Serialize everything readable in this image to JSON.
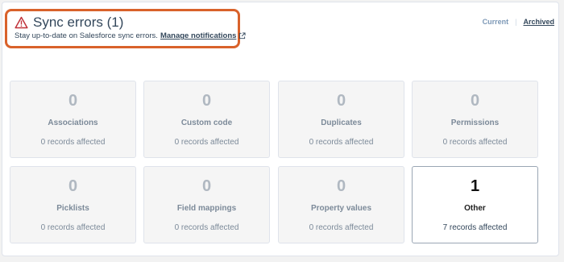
{
  "header": {
    "title": "Sync errors (1)",
    "subtitle": "Stay up-to-date on Salesforce sync errors.",
    "manage_link": "Manage notifications",
    "warning_icon": "warning-triangle-icon",
    "external_icon": "external-link-icon",
    "accent_color": "#d9622b"
  },
  "view_toggle": {
    "current": "Current",
    "separator": "|",
    "archived": "Archived"
  },
  "cards": [
    {
      "count": "0",
      "label": "Associations",
      "affected": "0 records affected"
    },
    {
      "count": "0",
      "label": "Custom code",
      "affected": "0 records affected"
    },
    {
      "count": "0",
      "label": "Duplicates",
      "affected": "0 records affected"
    },
    {
      "count": "0",
      "label": "Permissions",
      "affected": "0 records affected"
    },
    {
      "count": "0",
      "label": "Picklists",
      "affected": "0 records affected"
    },
    {
      "count": "0",
      "label": "Field mappings",
      "affected": "0 records affected"
    },
    {
      "count": "0",
      "label": "Property values",
      "affected": "0 records affected"
    },
    {
      "count": "1",
      "label": "Other",
      "affected": "7 records affected"
    }
  ]
}
